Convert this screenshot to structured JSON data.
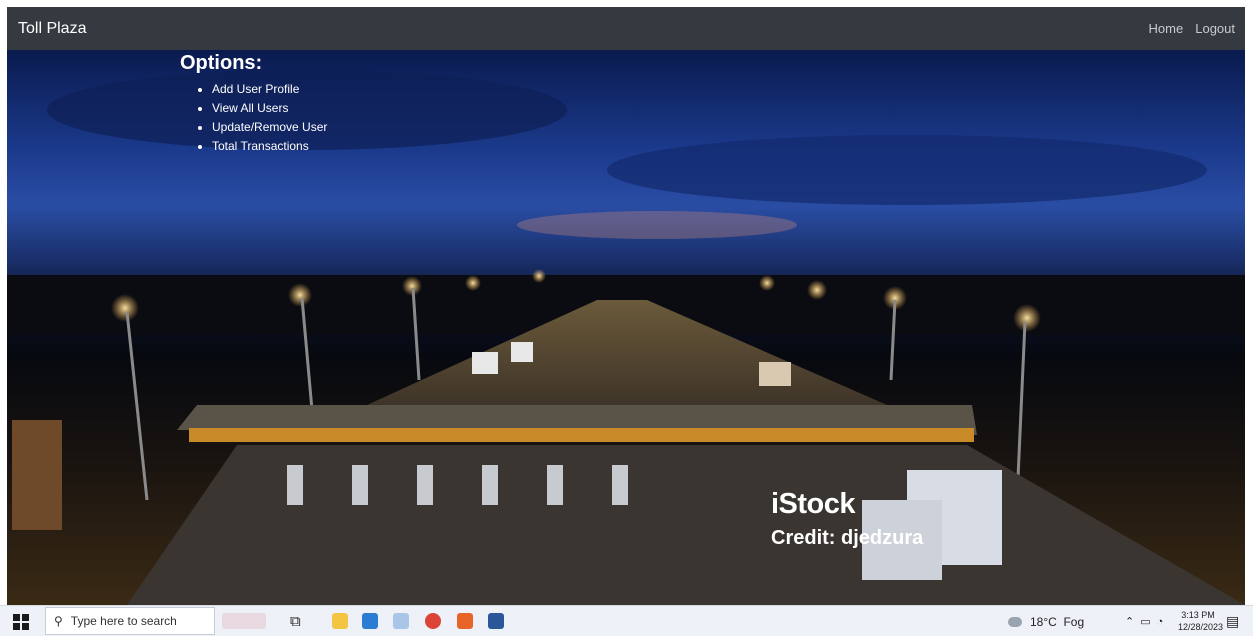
{
  "navbar": {
    "brand": "Toll Plaza",
    "links": [
      "Home",
      "Logout"
    ]
  },
  "options": {
    "title": "Options:",
    "items": [
      "Add User Profile",
      "View All Users",
      "Update/Remove User",
      "Total Transactions"
    ]
  },
  "watermark": {
    "logo": "iStock",
    "credit": "Credit: djedzura"
  },
  "taskbar": {
    "search_placeholder": "Type here to search",
    "weather": "18°C  Fog",
    "time": "3:13 PM",
    "date": "12/28/2023",
    "colors": {
      "edge": "#1e8c5a",
      "vscode": "#2b7cd3",
      "chrome": "#db4437",
      "word": "#2b579a"
    }
  }
}
